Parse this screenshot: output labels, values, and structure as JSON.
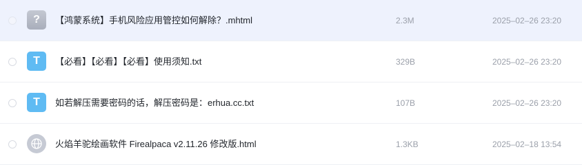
{
  "colors": {
    "selected_row_bg": "#eef2fd",
    "text_icon": "#5fbbf3",
    "unknown_icon": "#b5b9c4",
    "web_icon": "#c6cad4",
    "meta_text": "#9ba0aa"
  },
  "files": [
    {
      "icon": "unknown-file-icon",
      "icon_glyph": "?",
      "name": "【鸿蒙系统】手机风险应用管控如何解除？.mhtml",
      "size": "2.3M",
      "date": "2025–02–26 23:20",
      "selected": true
    },
    {
      "icon": "text-file-icon",
      "icon_glyph": "T",
      "name": "【必看】【必看】【必看】使用须知.txt",
      "size": "329B",
      "date": "2025–02–26 23:20",
      "selected": false
    },
    {
      "icon": "text-file-icon",
      "icon_glyph": "T",
      "name": "如若解压需要密码的话，解压密码是：erhua.cc.txt",
      "size": "107B",
      "date": "2025–02–26 23:20",
      "selected": false
    },
    {
      "icon": "globe-icon",
      "icon_glyph": "",
      "name": "火焰羊驼绘画软件 Firealpaca v2.11.26 修改版.html",
      "size": "1.3KB",
      "date": "2025–02–18 13:54",
      "selected": false
    }
  ]
}
